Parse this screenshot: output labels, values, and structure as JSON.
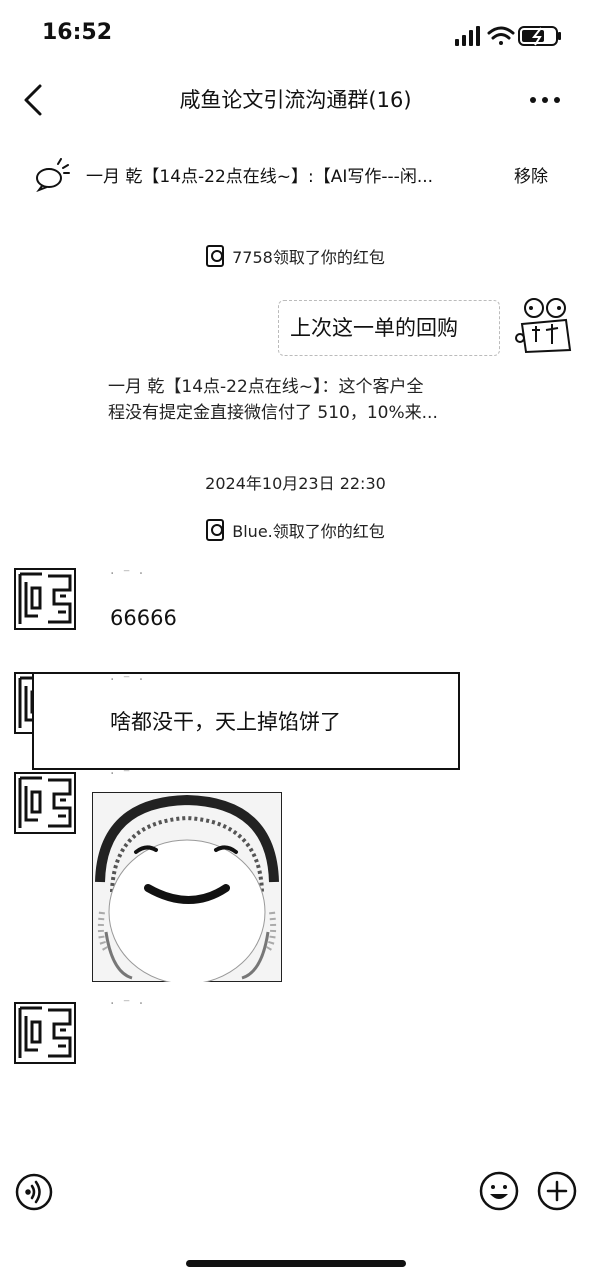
{
  "status_bar": {
    "time": "16:52"
  },
  "nav": {
    "title": "咸鱼论文引流沟通群(16)"
  },
  "pinned": {
    "text": "一月 乾【14点-22点在线~】:【AI写作---闲...",
    "remove_label": "移除"
  },
  "messages": {
    "sys1": "7758领取了你的红包",
    "self_bubble": "上次这一单的回购",
    "quote_line1": "一月 乾【14点-22点在线~】：这个客户全",
    "quote_line2": "程没有提定金直接微信付了 510，10%来...",
    "timestamp": "2024年10月23日 22:30",
    "sys2": "Blue.领取了你的红包",
    "msg1_name": "· ⁻ ·",
    "msg1_text": "66666",
    "msg2_name": "· ⁻ ·",
    "msg2_text": "啥都没干，天上掉馅饼了",
    "msg3_name": "· ⁻",
    "msg4_name": "· ⁻ ·"
  },
  "icons": {
    "back": "chevron-left-icon",
    "more": "more-dots-icon",
    "voice": "voice-icon",
    "emoji": "emoji-icon",
    "plus": "plus-icon"
  }
}
